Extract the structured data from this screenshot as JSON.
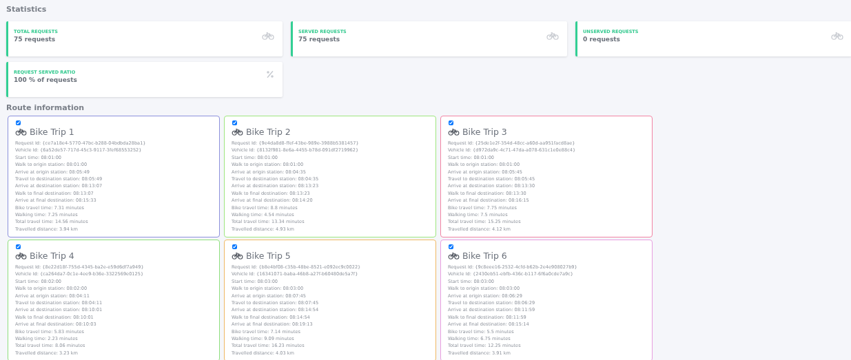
{
  "statistics": {
    "title": "Statistics",
    "cards": [
      {
        "label": "TOTAL REQUESTS",
        "value": "75 requests",
        "kind": "count"
      },
      {
        "label": "SERVED REQUESTS",
        "value": "75 requests",
        "kind": "count"
      },
      {
        "label": "UNSERVED REQUESTS",
        "value": "0 requests",
        "kind": "count"
      },
      {
        "label": "REQUEST SERVED RATIO",
        "value": "100 % of requests",
        "kind": "ratio"
      }
    ]
  },
  "route_information": {
    "title": "Route information",
    "trips": [
      {
        "title": "Bike Trip 1",
        "checked": true,
        "color": "#8c90dc",
        "lines": [
          "Request Id: {ce7a18e4-5770-47bc-b288-04bdbda28ba1}",
          "Vehicle Id: {6a52de57-717d-45c3-9117-3fef68553252}",
          "Start time: 08:01:00",
          "Walk to origin station: 08:01:00",
          "Arrive at origin station: 08:05:49",
          "Travel to destination station: 08:05:49",
          "Arrive at destination station: 08:13:07",
          "Walk to final destination: 08:13:07",
          "Arrive at final destination: 08:15:33",
          "Bike travel time: 7.31 minutes",
          "Walking time: 7.25 minutes",
          "Total travel time: 14.56 minutes",
          "Travelled distance: 3.94 km"
        ]
      },
      {
        "title": "Bike Trip 2",
        "checked": true,
        "color": "#9ee67e",
        "lines": [
          "Request Id: {9e4da8d8-ffef-43be-989e-3988b5381457}",
          "Vehicle Id: {8132f981-8e6a-4455-b78d-091df2719962}",
          "Start time: 08:01:00",
          "Walk to origin station: 08:01:00",
          "Arrive at origin station: 08:04:35",
          "Travel to destination station: 08:04:35",
          "Arrive at destination station: 08:13:23",
          "Walk to final destination: 08:13:23",
          "Arrive at final destination: 08:14:20",
          "Bike travel time: 8.8 minutes",
          "Walking time: 4.54 minutes",
          "Total travel time: 13.34 minutes",
          "Travelled distance: 4.93 km"
        ]
      },
      {
        "title": "Bike Trip 3",
        "checked": true,
        "color": "#f284a4",
        "lines": [
          "Request Id: {25de1e2f-354d-48cc-a60d-aa951facd8ae}",
          "Vehicle Id: {d972da9c-4c71-47da-a078-631c1e0e88c4}",
          "Start time: 08:01:00",
          "Walk to origin station: 08:01:00",
          "Arrive at origin station: 08:05:45",
          "Travel to destination station: 08:05:45",
          "Arrive at destination station: 08:13:30",
          "Walk to final destination: 08:13:30",
          "Arrive at final destination: 08:16:15",
          "Bike travel time: 7.75 minutes",
          "Walking time: 7.5 minutes",
          "Total travel time: 15.25 minutes",
          "Travelled distance: 4.12 km"
        ]
      },
      {
        "title": "Bike Trip 4",
        "checked": true,
        "color": "#8ee07c",
        "lines": [
          "Request Id: {8e22d18f-755d-4345-ba2e-e59d6df7a949}",
          "Vehicle Id: {ca264da7-0c1e-4ee9-b36e-3322569e0125}",
          "Start time: 08:02:00",
          "Walk to origin station: 08:02:00",
          "Arrive at origin station: 08:04:11",
          "Travel to destination station: 08:04:11",
          "Arrive at destination station: 08:10:01",
          "Walk to final destination: 08:10:01",
          "Arrive at final destination: 08:10:03",
          "Bike travel time: 5.83 minutes",
          "Walking time: 2.23 minutes",
          "Total travel time: 8.06 minutes",
          "Travelled distance: 3.23 km"
        ]
      },
      {
        "title": "Bike Trip 5",
        "checked": true,
        "color": "#f0b862",
        "lines": [
          "Request Id: {b8e4bf08-c35b-48be-8521-e092ec9c0022}",
          "Vehicle Id: {16341071-baba-46b8-a27f-b60480de5a7f}",
          "Start time: 08:03:00",
          "Walk to origin station: 08:03:00",
          "Arrive at origin station: 08:07:45",
          "Travel to destination station: 08:07:45",
          "Arrive at destination station: 08:14:54",
          "Walk to final destination: 08:14:54",
          "Arrive at final destination: 08:19:13",
          "Bike travel time: 7.14 minutes",
          "Walking time: 9.09 minutes",
          "Total travel time: 16.23 minutes",
          "Travelled distance: 4.03 km"
        ]
      },
      {
        "title": "Bike Trip 6",
        "checked": true,
        "color": "#e89ee0",
        "lines": [
          "Request Id: {9c8eee16-2532-4cfd-b62b-2e4e908027b9}",
          "Vehicle Id: {2430eb51-ebfb-436c-b117-6f6a0cde7a9c}",
          "Start time: 08:03:00",
          "Walk to origin station: 08:03:00",
          "Arrive at origin station: 08:06:29",
          "Travel to destination station: 08:06:29",
          "Arrive at destination station: 08:11:59",
          "Walk to final destination: 08:11:59",
          "Arrive at final destination: 08:15:14",
          "Bike travel time: 5.5 minutes",
          "Walking time: 6.75 minutes",
          "Total travel time: 12.25 minutes",
          "Travelled distance: 3.91 km"
        ]
      }
    ]
  }
}
